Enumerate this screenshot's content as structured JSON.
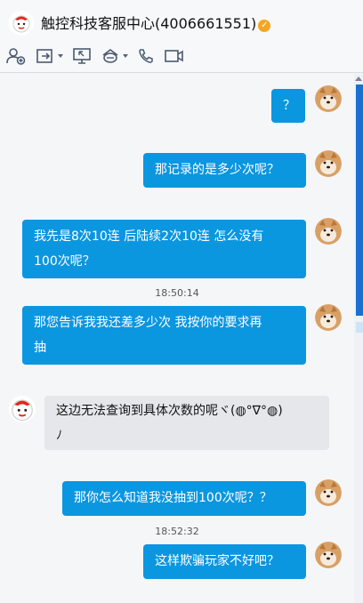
{
  "header": {
    "contact_name": "触控科技客服中心(4006661551)",
    "verified_icon": "verified-badge-icon"
  },
  "toolbar": {
    "icons": [
      "add-contact-icon",
      "share-screen-icon",
      "remote-assist-icon",
      "app-bag-icon",
      "phone-call-icon",
      "video-call-icon"
    ]
  },
  "colors": {
    "outgoing_bubble": "#0b96e0",
    "incoming_bubble": "#e5e7ea",
    "verified_badge": "#f4a622",
    "scroll_track": "#1b6fd1"
  },
  "messages": [
    {
      "from": "me",
      "text": "？"
    },
    {
      "from": "me",
      "text": "那记录的是多少次呢？"
    },
    {
      "from": "me",
      "text_line1": "我先是8次10连 后陆续2次10连 怎么没有",
      "text_line2": "100次呢？"
    },
    {
      "time": "18:50:14"
    },
    {
      "from": "me",
      "text_line1": "那您告诉我我还差多少次 我按你的要求再",
      "text_line2": "抽"
    },
    {
      "from": "service",
      "text_line1": "这边无法查询到具体次数的呢ヾ(◍°∇°◍)",
      "text_line2": "ﾉ"
    },
    {
      "from": "me",
      "text": "那你怎么知道我没抽到100次呢？？"
    },
    {
      "time": "18:52:32"
    },
    {
      "from": "me",
      "text": "这样欺骗玩家不好吧？"
    }
  ]
}
